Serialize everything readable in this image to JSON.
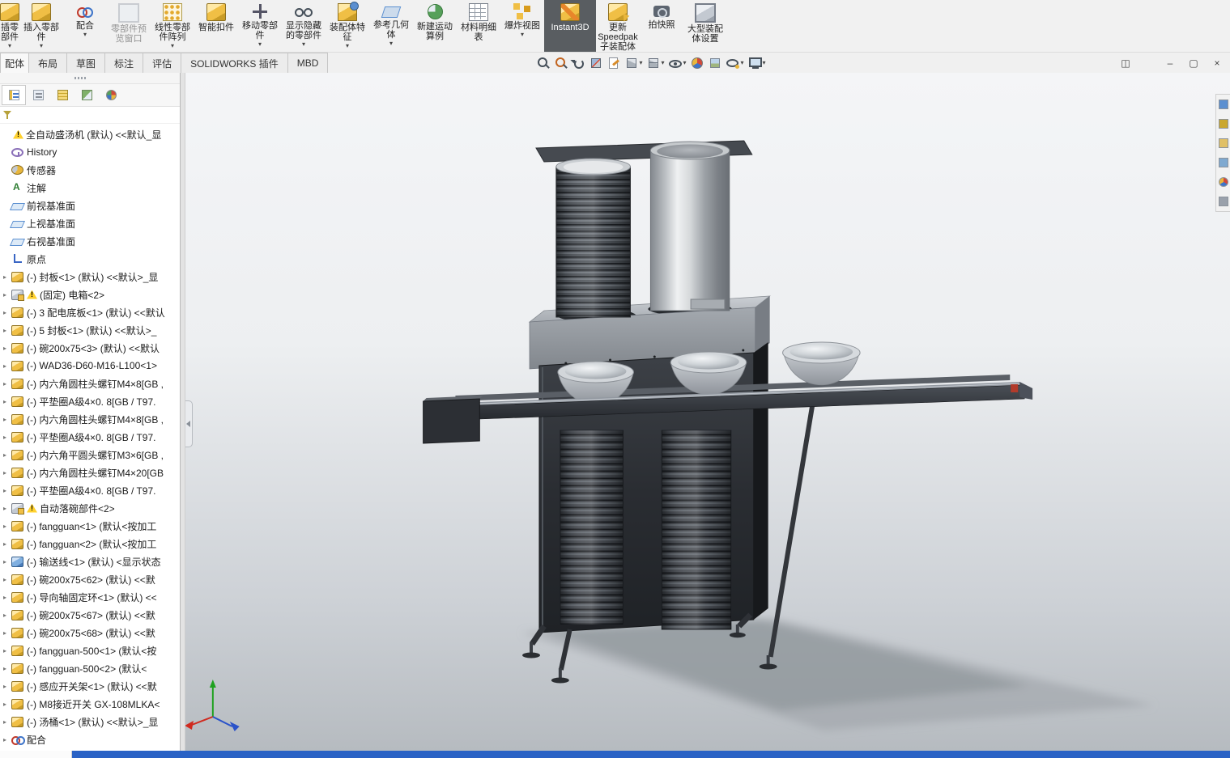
{
  "colors": {
    "ribbon_bg": "#f1f1f1",
    "active_button_bg": "#595d61",
    "taskbar_blue": "#2a62c5",
    "viewport_top": "#f4f5f7",
    "viewport_bottom": "#b6bbc0"
  },
  "ribbon": {
    "buttons": [
      {
        "label": "插零部件",
        "icon": "cube-gold-icon",
        "cls": "partial has-arrow",
        "name": "edit-component-partial-button"
      },
      {
        "label": "插入零部件",
        "icon": "cube-gold-icon",
        "cls": "has-arrow",
        "name": "insert-components-button"
      },
      {
        "label": "配合",
        "icon": "mate-ribbon-icon",
        "cls": "has-arrow",
        "name": "mate-button"
      },
      {
        "label": "零部件预览窗口",
        "icon": "preview-icon",
        "cls": "disabled",
        "name": "component-preview-window-button"
      },
      {
        "label": "线性零部件阵列",
        "icon": "pattern-icon",
        "cls": "has-arrow",
        "name": "linear-component-pattern-button"
      },
      {
        "label": "智能扣件",
        "icon": "smart-fastener-icon",
        "cls": "",
        "name": "smart-fasteners-button"
      },
      {
        "label": "移动零部件",
        "icon": "move-icon",
        "cls": "has-arrow",
        "name": "move-component-button"
      },
      {
        "label": "显示隐藏的零部件",
        "icon": "show-hidden-icon",
        "cls": "has-arrow",
        "name": "show-hidden-components-button"
      },
      {
        "label": "装配体特征",
        "icon": "assembly-feature-icon",
        "cls": "has-arrow",
        "name": "assembly-features-button"
      },
      {
        "label": "参考几何体",
        "icon": "ref-geometry-icon",
        "cls": "has-arrow",
        "name": "reference-geometry-button"
      },
      {
        "label": "新建运动算例",
        "icon": "motion-study-icon",
        "cls": "",
        "name": "new-motion-study-button"
      },
      {
        "label": "材料明细表",
        "icon": "bom-icon",
        "cls": "",
        "name": "bill-of-materials-button"
      },
      {
        "label": "爆炸视图",
        "icon": "exploded-view-icon",
        "cls": "has-arrow",
        "name": "exploded-view-button"
      },
      {
        "label": "Instant3D",
        "icon": "instant3d-icon",
        "cls": "active wide",
        "name": "instant3d-button"
      },
      {
        "label": "更新Speedpak子装配体",
        "icon": "speedpak-icon",
        "cls": "",
        "name": "update-speedpak-button"
      },
      {
        "label": "拍快照",
        "icon": "snapshot-icon",
        "cls": "",
        "name": "take-snapshot-button"
      },
      {
        "label": "大型装配体设置",
        "icon": "large-assembly-icon",
        "cls": "",
        "name": "large-assembly-settings-button"
      }
    ]
  },
  "tabs": {
    "items": [
      {
        "label": "配体",
        "cls": "partial active",
        "name": "tab-assembly"
      },
      {
        "label": "布局",
        "name": "tab-layout"
      },
      {
        "label": "草图",
        "name": "tab-sketch"
      },
      {
        "label": "标注",
        "name": "tab-annotation"
      },
      {
        "label": "评估",
        "name": "tab-evaluate"
      },
      {
        "label": "SOLIDWORKS 插件",
        "name": "tab-solidworks-addins"
      },
      {
        "label": "MBD",
        "name": "tab-mbd"
      }
    ]
  },
  "view_toolbar": {
    "items": [
      {
        "icon": "zoom-to-fit-icon",
        "name": "zoom-to-fit-button"
      },
      {
        "icon": "zoom-to-area-icon",
        "name": "zoom-to-area-button"
      },
      {
        "icon": "previous-view-icon",
        "name": "previous-view-button"
      },
      {
        "icon": "section-view-icon",
        "name": "section-view-button"
      },
      {
        "icon": "annotation-view-icon",
        "name": "annotation-view-button"
      },
      {
        "icon": "display-style-icon",
        "cls": "has-arrow",
        "name": "display-style-button"
      },
      {
        "icon": "view-orientation-icon",
        "cls": "has-arrow",
        "name": "view-orientation-button"
      },
      {
        "icon": "hide-show-items-icon",
        "cls": "has-arrow",
        "name": "hide-show-items-button"
      },
      {
        "icon": "edit-appearance-icon",
        "name": "edit-appearance-button"
      },
      {
        "icon": "apply-scene-icon",
        "name": "apply-scene-button"
      },
      {
        "icon": "view-settings-icon",
        "cls": "has-arrow",
        "name": "view-settings-button"
      },
      {
        "icon": "full-screen-icon",
        "cls": "has-arrow",
        "name": "full-screen-button"
      }
    ]
  },
  "window_controls": {
    "items": [
      {
        "glyph": "◫",
        "cls": "gap",
        "name": "toggle-panes-button"
      },
      {
        "glyph": "–",
        "name": "minimize-button"
      },
      {
        "glyph": "▢",
        "name": "restore-button"
      },
      {
        "glyph": "×",
        "name": "close-button"
      }
    ]
  },
  "left_panel": {
    "tabs": [
      {
        "icon": "featuremanager-icon",
        "cls": "active",
        "name": "featuremanager-tab"
      },
      {
        "icon": "propertymanager-icon",
        "name": "propertymanager-tab"
      },
      {
        "icon": "configurationmanager-icon",
        "name": "configurationmanager-tab"
      },
      {
        "icon": "dimxpertmanager-icon",
        "name": "dimxpertmanager-tab"
      },
      {
        "icon": "displaymanager-icon",
        "name": "displaymanager-tab"
      }
    ],
    "tree": {
      "items": [
        {
          "cls": "has-warn",
          "icon": "none-icon",
          "label": "全自动盛汤机 (默认) <<默认_显",
          "name": "tree-item-root"
        },
        {
          "icon": "history-icon",
          "label": "History",
          "name": "tree-item-history"
        },
        {
          "icon": "sensor-icon",
          "label": "传感器",
          "name": "tree-item-sensors"
        },
        {
          "icon": "annotation-icon",
          "label": "注解",
          "name": "tree-item-annotations"
        },
        {
          "icon": "plane-icon",
          "label": "前视基准面",
          "name": "tree-item-front-plane"
        },
        {
          "icon": "plane-icon",
          "label": "上视基准面",
          "name": "tree-item-top-plane"
        },
        {
          "icon": "plane-icon",
          "label": "右视基准面",
          "name": "tree-item-right-plane"
        },
        {
          "icon": "origin-icon",
          "label": "原点",
          "name": "tree-item-origin"
        },
        {
          "cls": "has-caret",
          "icon": "part-icon",
          "label": "(-) 封板<1> (默认) <<默认>_显",
          "name": "tree-item-component"
        },
        {
          "cls": "has-caret has-warn",
          "icon": "assembly-icon",
          "label": "(固定) 电箱<2>",
          "name": "tree-item-component"
        },
        {
          "cls": "has-caret",
          "icon": "part-icon",
          "label": "(-) 3 配电底板<1> (默认) <<默认",
          "name": "tree-item-component"
        },
        {
          "cls": "has-caret",
          "icon": "part-icon",
          "label": "(-) 5 封板<1> (默认) <<默认>_",
          "name": "tree-item-component"
        },
        {
          "cls": "has-caret",
          "icon": "part-icon",
          "label": "(-) 碗200x75<3> (默认) <<默认",
          "name": "tree-item-component"
        },
        {
          "cls": "has-caret",
          "icon": "part-icon",
          "label": "(-) WAD36-D60-M16-L100<1>",
          "name": "tree-item-component"
        },
        {
          "cls": "has-caret",
          "icon": "part-icon",
          "label": "(-) 内六角圆柱头螺钉M4×8[GB ,",
          "name": "tree-item-component"
        },
        {
          "cls": "has-caret",
          "icon": "part-icon",
          "label": "(-) 平垫圈A级4×0. 8[GB / T97.",
          "name": "tree-item-component"
        },
        {
          "cls": "has-caret",
          "icon": "part-icon",
          "label": "(-) 内六角圆柱头螺钉M4×8[GB ,",
          "name": "tree-item-component"
        },
        {
          "cls": "has-caret",
          "icon": "part-icon",
          "label": "(-) 平垫圈A级4×0. 8[GB / T97.",
          "name": "tree-item-component"
        },
        {
          "cls": "has-caret",
          "icon": "part-icon",
          "label": "(-) 内六角平圆头螺钉M3×6[GB ,",
          "name": "tree-item-component"
        },
        {
          "cls": "has-caret",
          "icon": "part-icon",
          "label": "(-) 内六角圆柱头螺钉M4×20[GB",
          "name": "tree-item-component"
        },
        {
          "cls": "has-caret",
          "icon": "part-icon",
          "label": "(-) 平垫圈A级4×0. 8[GB / T97.",
          "name": "tree-item-component"
        },
        {
          "cls": "has-caret has-warn",
          "icon": "assembly-icon",
          "label": "自动落碗部件<2>",
          "name": "tree-item-component"
        },
        {
          "cls": "has-caret",
          "icon": "part-icon",
          "label": "(-) fangguan<1> (默认<按加工",
          "name": "tree-item-component"
        },
        {
          "cls": "has-caret",
          "icon": "part-icon",
          "label": "(-) fangguan<2> (默认<按加工",
          "name": "tree-item-component"
        },
        {
          "cls": "has-caret",
          "icon": "part-blue-icon",
          "label": "(-) 输送线<1> (默认) <显示状态",
          "name": "tree-item-component"
        },
        {
          "cls": "has-caret",
          "icon": "part-icon",
          "label": "(-) 碗200x75<62> (默认) <<默",
          "name": "tree-item-component"
        },
        {
          "cls": "has-caret",
          "icon": "part-icon",
          "label": "(-) 导向轴固定环<1> (默认) <<",
          "name": "tree-item-component"
        },
        {
          "cls": "has-caret",
          "icon": "part-icon",
          "label": "(-) 碗200x75<67> (默认) <<默",
          "name": "tree-item-component"
        },
        {
          "cls": "has-caret",
          "icon": "part-icon",
          "label": "(-) 碗200x75<68> (默认) <<默",
          "name": "tree-item-component"
        },
        {
          "cls": "has-caret",
          "icon": "part-icon",
          "label": "(-) fangguan-500<1> (默认<按",
          "name": "tree-item-component"
        },
        {
          "cls": "has-caret",
          "icon": "part-icon",
          "label": "(-) fangguan-500<2> (默认<",
          "name": "tree-item-component"
        },
        {
          "cls": "has-caret",
          "icon": "part-icon",
          "label": "(-) 感应开关架<1> (默认) <<默",
          "name": "tree-item-component"
        },
        {
          "cls": "has-caret",
          "icon": "part-icon",
          "label": "(-) M8接近开关 GX-108MLKA<",
          "name": "tree-item-component"
        },
        {
          "cls": "has-caret",
          "icon": "part-icon",
          "label": "(-) 汤桶<1> (默认) <<默认>_显",
          "name": "tree-item-component"
        },
        {
          "cls": "has-caret",
          "icon": "mates-icon",
          "label": "配合",
          "name": "tree-item-mates"
        }
      ]
    }
  },
  "task_pane": {
    "items": [
      {
        "icon": "resources-icon",
        "name": "solidworks-resources-tab"
      },
      {
        "icon": "design-library-icon",
        "name": "design-library-tab"
      },
      {
        "icon": "file-explorer-icon",
        "name": "file-explorer-tab"
      },
      {
        "icon": "view-palette-icon",
        "name": "view-palette-tab"
      },
      {
        "icon": "appearances-icon",
        "name": "appearances-tab"
      },
      {
        "icon": "custom-properties-icon",
        "name": "custom-properties-tab"
      }
    ]
  }
}
